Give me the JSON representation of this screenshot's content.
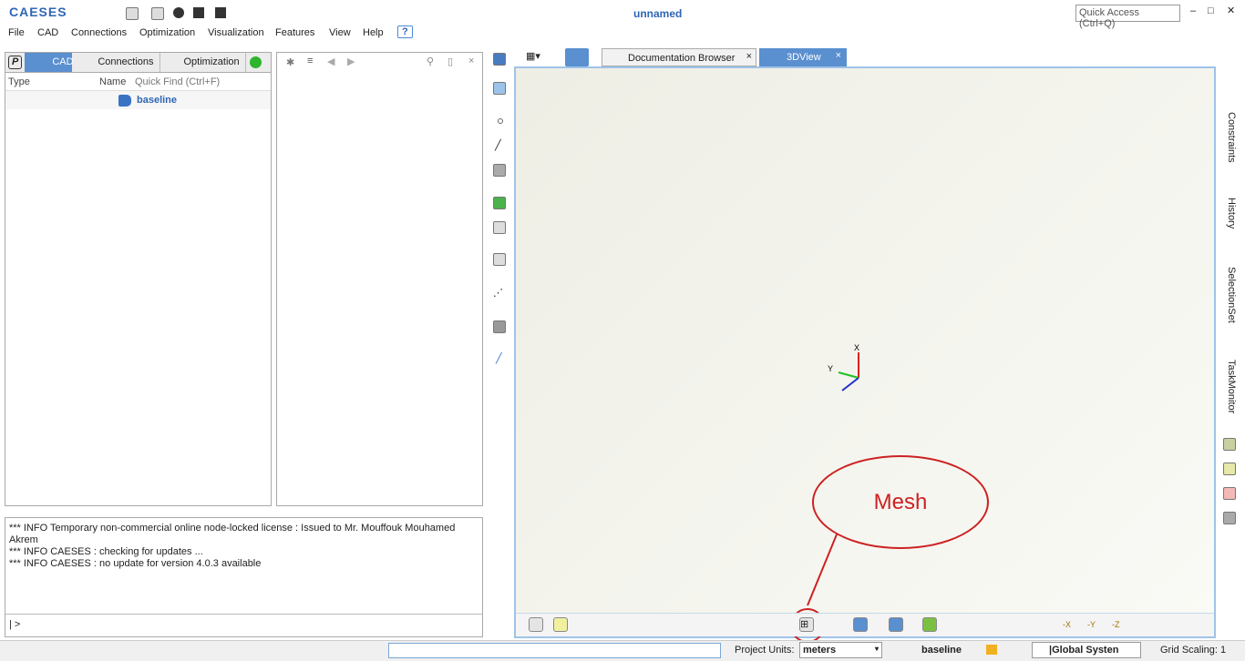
{
  "app": {
    "logo": "CAESES",
    "title": "unnamed",
    "quick_access": "Quick Access (Ctrl+Q)"
  },
  "menu": [
    "File",
    "CAD",
    "Connections",
    "Optimization",
    "Visualization",
    "Features",
    "View",
    "Help"
  ],
  "left_tabs": {
    "p": "P",
    "cad": "CAD",
    "connections": "Connections",
    "optimization": "Optimization"
  },
  "tree": {
    "col_type": "Type",
    "col_name": "Name",
    "quick_find": "Quick Find (Ctrl+F)",
    "item": "baseline"
  },
  "view_tabs": [
    "Documentation Browser",
    "3DView"
  ],
  "side_tabs": [
    "Constraints",
    "History",
    "SelectionSet",
    "TaskMonitor"
  ],
  "console": {
    "lines": [
      "*** INFO Temporary non-commercial online node-locked license : Issued to Mr. Mouffouk Mouhamed Akrem",
      "*** INFO CAESES : checking for updates ...",
      "*** INFO CAESES : no update for version 4.0.3 available"
    ],
    "prompt": "| >"
  },
  "annotation": {
    "label": "Mesh",
    "color": "#cc2222"
  },
  "axes": {
    "x": "X",
    "y": "Y",
    "z": "Z"
  },
  "status": {
    "units_label": "Project Units:",
    "units": "meters",
    "baseline": "baseline",
    "coord": "|Global Systen",
    "grid": "Grid Scaling: 1"
  },
  "bottom_toolbar": [
    "-X",
    "-Y",
    "-Z"
  ]
}
